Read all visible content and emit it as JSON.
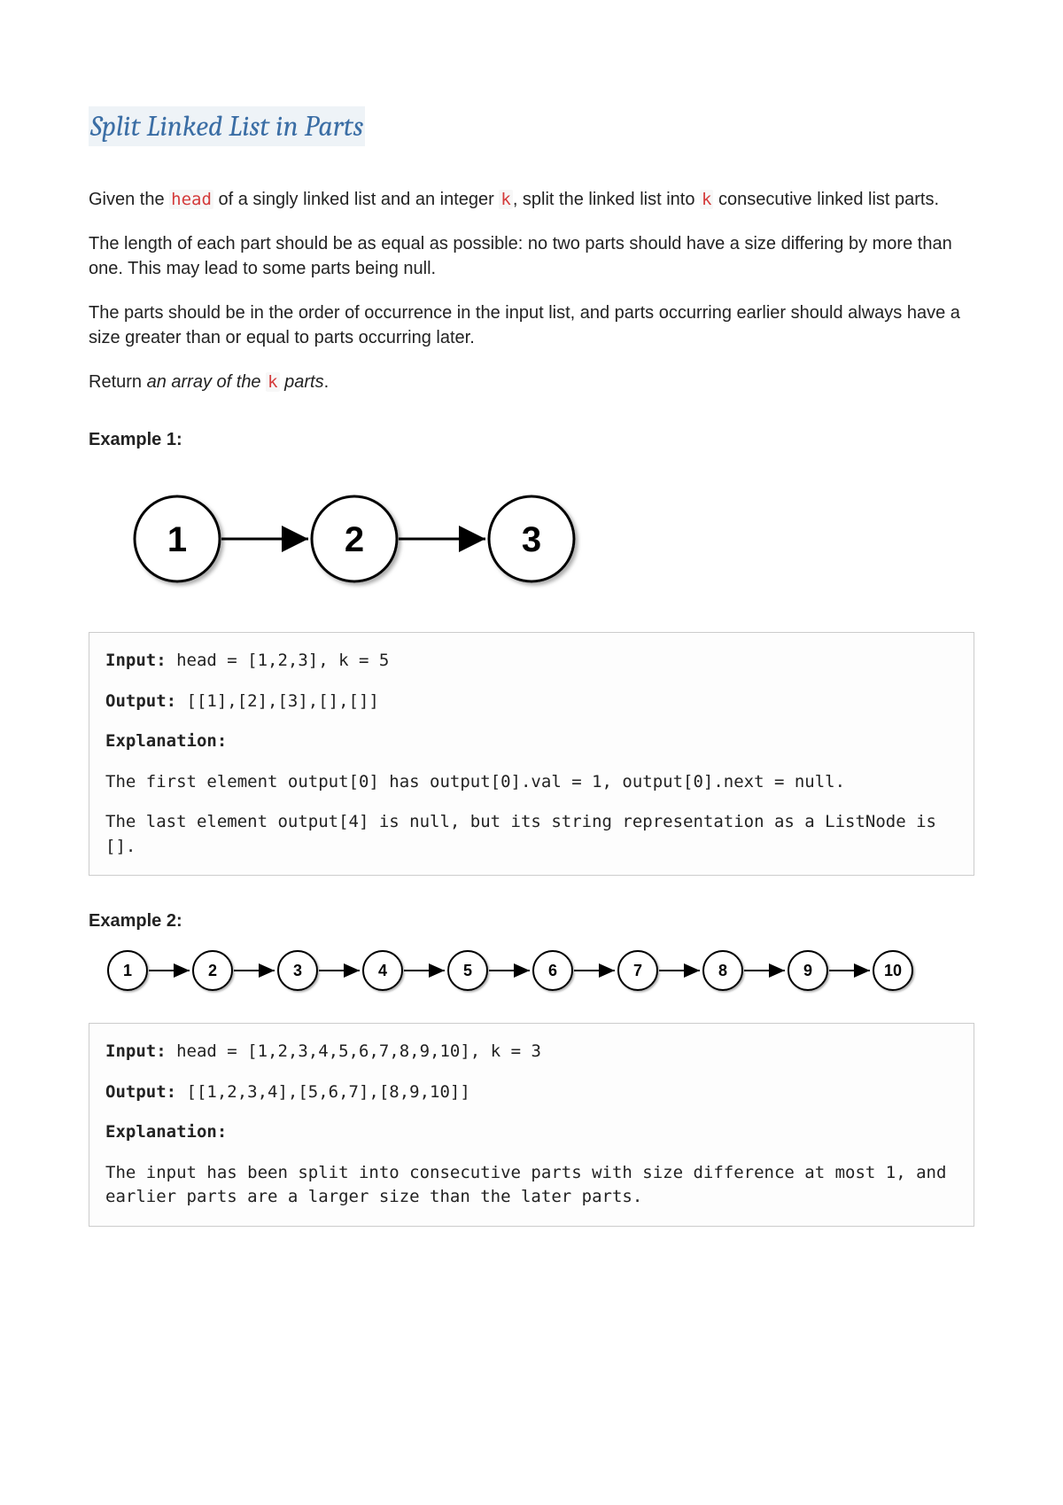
{
  "title": "Split Linked List in Parts",
  "p1_pre": "Given the ",
  "code_head": "head",
  "p1_mid": " of a singly linked list and an integer ",
  "code_k": "k",
  "p1_post": ", split the linked list into ",
  "p1_end": " consecutive linked list parts.",
  "p2": "The length of each part should be as equal as possible: no two parts should have a size differing by more than one. This may lead to some parts being null.",
  "p3": "The parts should be in the order of occurrence in the input list, and parts occurring earlier should always have a size greater than or equal to parts occurring later.",
  "p4_pre": "Return ",
  "p4_ital1": "an array of the ",
  "p4_ital2": " parts",
  "p4_post": ".",
  "ex1_h": "Example 1:",
  "ex1_nodes": [
    "1",
    "2",
    "3"
  ],
  "ex1_input_lbl": "Input:",
  "ex1_input": " head = [1,2,3], k = 5",
  "ex1_output_lbl": "Output:",
  "ex1_output": " [[1],[2],[3],[],[]]",
  "ex1_expl_lbl": "Explanation:",
  "ex1_expl1": "The first element output[0] has output[0].val = 1, output[0].next = null.",
  "ex1_expl2": "The last element output[4] is null, but its string representation as a ListNode is [].",
  "ex2_h": "Example 2:",
  "ex2_nodes": [
    "1",
    "2",
    "3",
    "4",
    "5",
    "6",
    "7",
    "8",
    "9",
    "10"
  ],
  "ex2_input_lbl": "Input:",
  "ex2_input": " head = [1,2,3,4,5,6,7,8,9,10], k = 3",
  "ex2_output_lbl": "Output:",
  "ex2_output": " [[1,2,3,4],[5,6,7],[8,9,10]]",
  "ex2_expl_lbl": "Explanation:",
  "ex2_expl1": "The input has been split into consecutive parts with size difference at most 1, and earlier parts are a larger size than the later parts."
}
